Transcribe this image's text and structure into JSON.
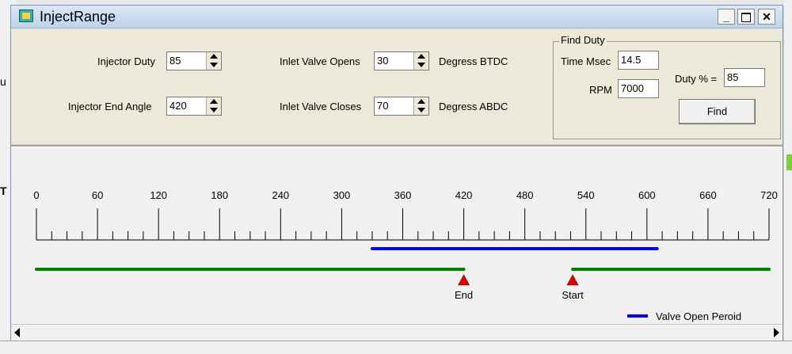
{
  "window": {
    "title": "InjectRange",
    "icon": "app-icon"
  },
  "background": {
    "left_text_1": "u",
    "left_text_2": "T"
  },
  "form": {
    "injector_duty": {
      "label": "Injector Duty",
      "value": "85"
    },
    "injector_end_angle": {
      "label": "Injector End Angle",
      "value": "420"
    },
    "inlet_valve_opens": {
      "label": "Inlet Valve Opens",
      "value": "30",
      "unit": "Degress BTDC"
    },
    "inlet_valve_closes": {
      "label": "Inlet Valve Closes",
      "value": "70",
      "unit": "Degress ABDC"
    }
  },
  "find_duty": {
    "title": "Find Duty",
    "time_label": "Time Msec",
    "time_value": "14.5",
    "rpm_label": "RPM",
    "rpm_value": "7000",
    "duty_label": "Duty % =",
    "duty_value": "85",
    "find_button": "Find"
  },
  "scale": {
    "min": 0,
    "max": 720,
    "major_step": 60,
    "minor_step": 15,
    "tick_labels": [
      "0",
      "60",
      "120",
      "180",
      "240",
      "300",
      "360",
      "420",
      "480",
      "540",
      "600",
      "660",
      "720"
    ]
  },
  "valve_open_period": {
    "start": 330,
    "end": 610,
    "color": "#0000ff"
  },
  "injection_ranges": [
    {
      "start": 0,
      "end": 420
    },
    {
      "start": 527,
      "end": 720
    }
  ],
  "injection_color": "#008000",
  "markers": [
    {
      "label": "End",
      "deg": 420
    },
    {
      "label": "Start",
      "deg": 527
    }
  ],
  "marker_color": "#dd0000",
  "legend": {
    "label": "Valve Open Peroid"
  }
}
